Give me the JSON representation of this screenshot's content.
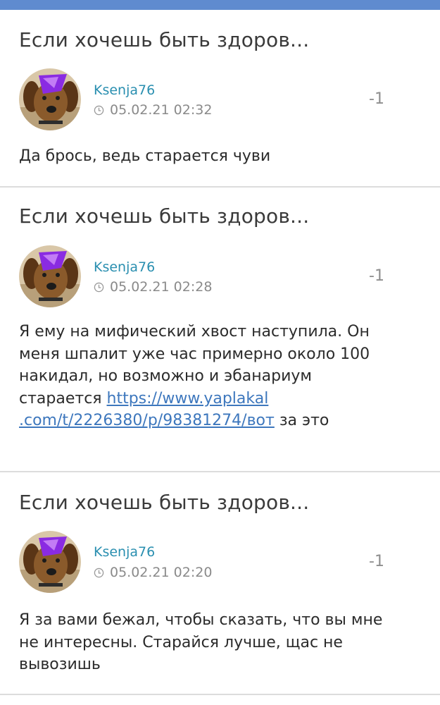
{
  "posts": [
    {
      "title": "Если хочешь быть здоров...",
      "author": "Ksenja76",
      "datetime": "05.02.21 02:32",
      "rating": "-1",
      "body_before": "Да брось, ведь старается чуви",
      "link_line1": "",
      "link_line2": "",
      "body_after": ""
    },
    {
      "title": "Если хочешь быть здоров...",
      "author": "Ksenja76",
      "datetime": "05.02.21 02:28",
      "rating": "-1",
      "body_before": "Я ему на мифический хвост наступила. Он меня шпалит уже час примерно около 100 накидал, но возможно и эбанариум старается ",
      "link_line1": "https://www.yaplakal",
      "link_line2": ".com/t/2226380/p/98381274/вот",
      "body_after": " за это"
    },
    {
      "title": "Если хочешь быть здоров...",
      "author": "Ksenja76",
      "datetime": "05.02.21 02:20",
      "rating": "-1",
      "body_before": "Я за вами бежал, чтобы сказать, что вы мне не интересны. Старайся лучше, щас не вывозишь",
      "link_line1": "",
      "link_line2": "",
      "body_after": ""
    }
  ],
  "icons": {
    "clock": "clock-icon",
    "avatar": "dog-avatar"
  },
  "colors": {
    "topbar": "#5f8bcf",
    "author": "#2a8fb0",
    "link": "#3d77bd",
    "meta": "#8a8a8a"
  }
}
